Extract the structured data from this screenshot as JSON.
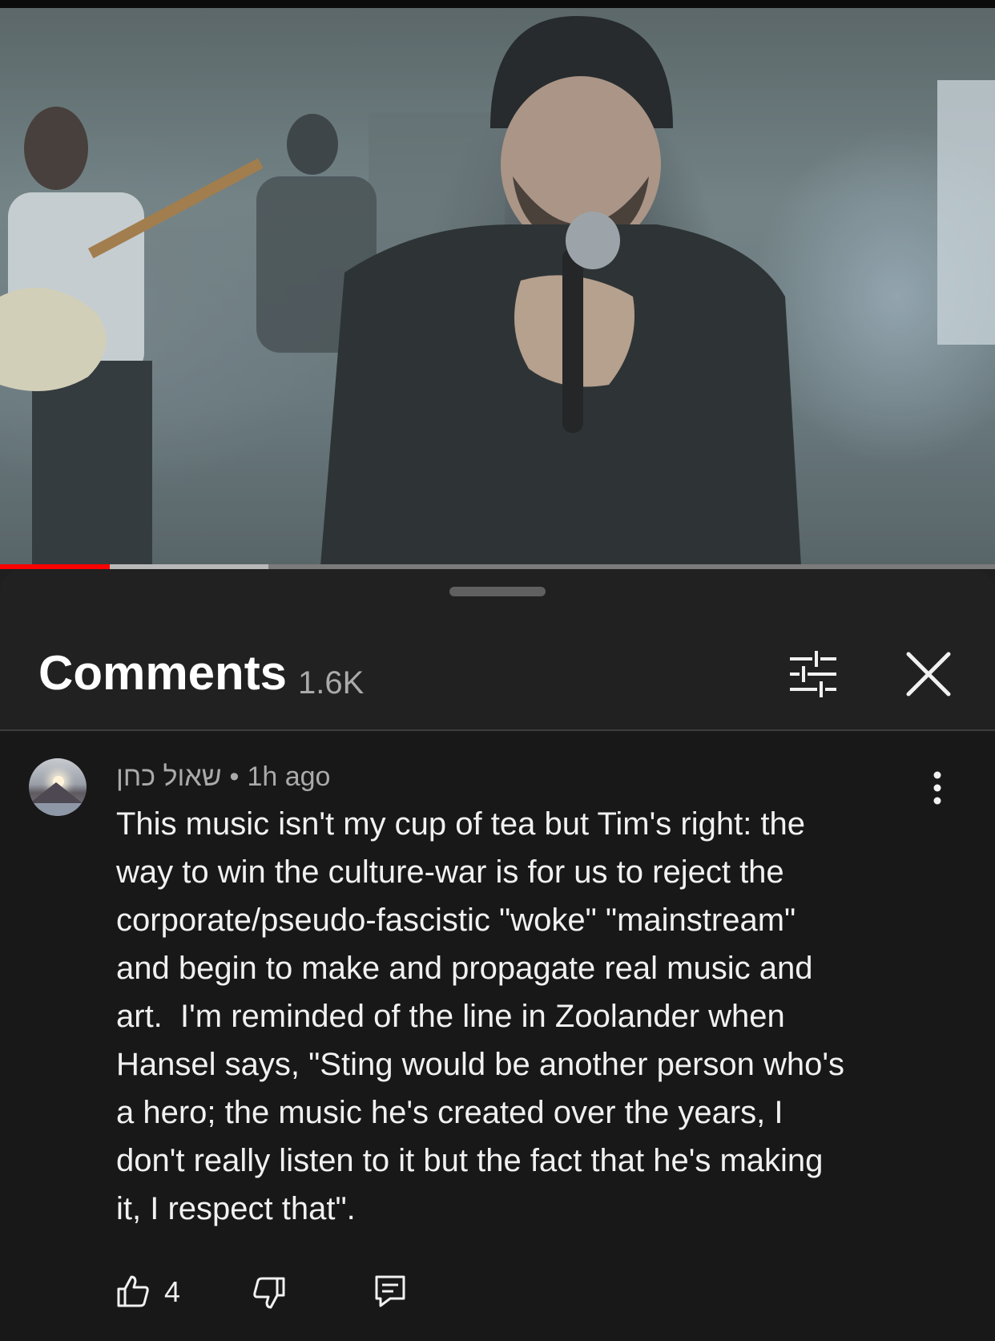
{
  "video": {
    "progress_played": 0.11,
    "progress_buffered": 0.27
  },
  "comments_panel": {
    "title": "Comments",
    "count": "1.6K",
    "filter_icon": "sliders-icon",
    "close_icon": "close-icon"
  },
  "comment": {
    "author": "שאול כחן",
    "time": "1h ago",
    "text": "This music isn't my cup of tea but Tim's right: the\nway to win the culture-war is for us to reject the\ncorporate/pseudo-fascistic \"woke\" \"mainstream\"\nand begin to make and propagate real music and\nart.  I'm reminded of the line in Zoolander when\nHansel says, \"Sting would be another person who's\na hero; the music he's created over the years, I\ndon't really listen to it but the fact that he's making\nit, I respect that\".",
    "like_count": "4",
    "icons": [
      "thumbs-up-icon",
      "thumbs-down-icon",
      "reply-icon",
      "more-vert-icon"
    ]
  },
  "colors": {
    "accent_red": "#ff0000",
    "sheet_bg": "#212121",
    "comment_bg": "#181818",
    "secondary_text": "#aaaaaa"
  }
}
